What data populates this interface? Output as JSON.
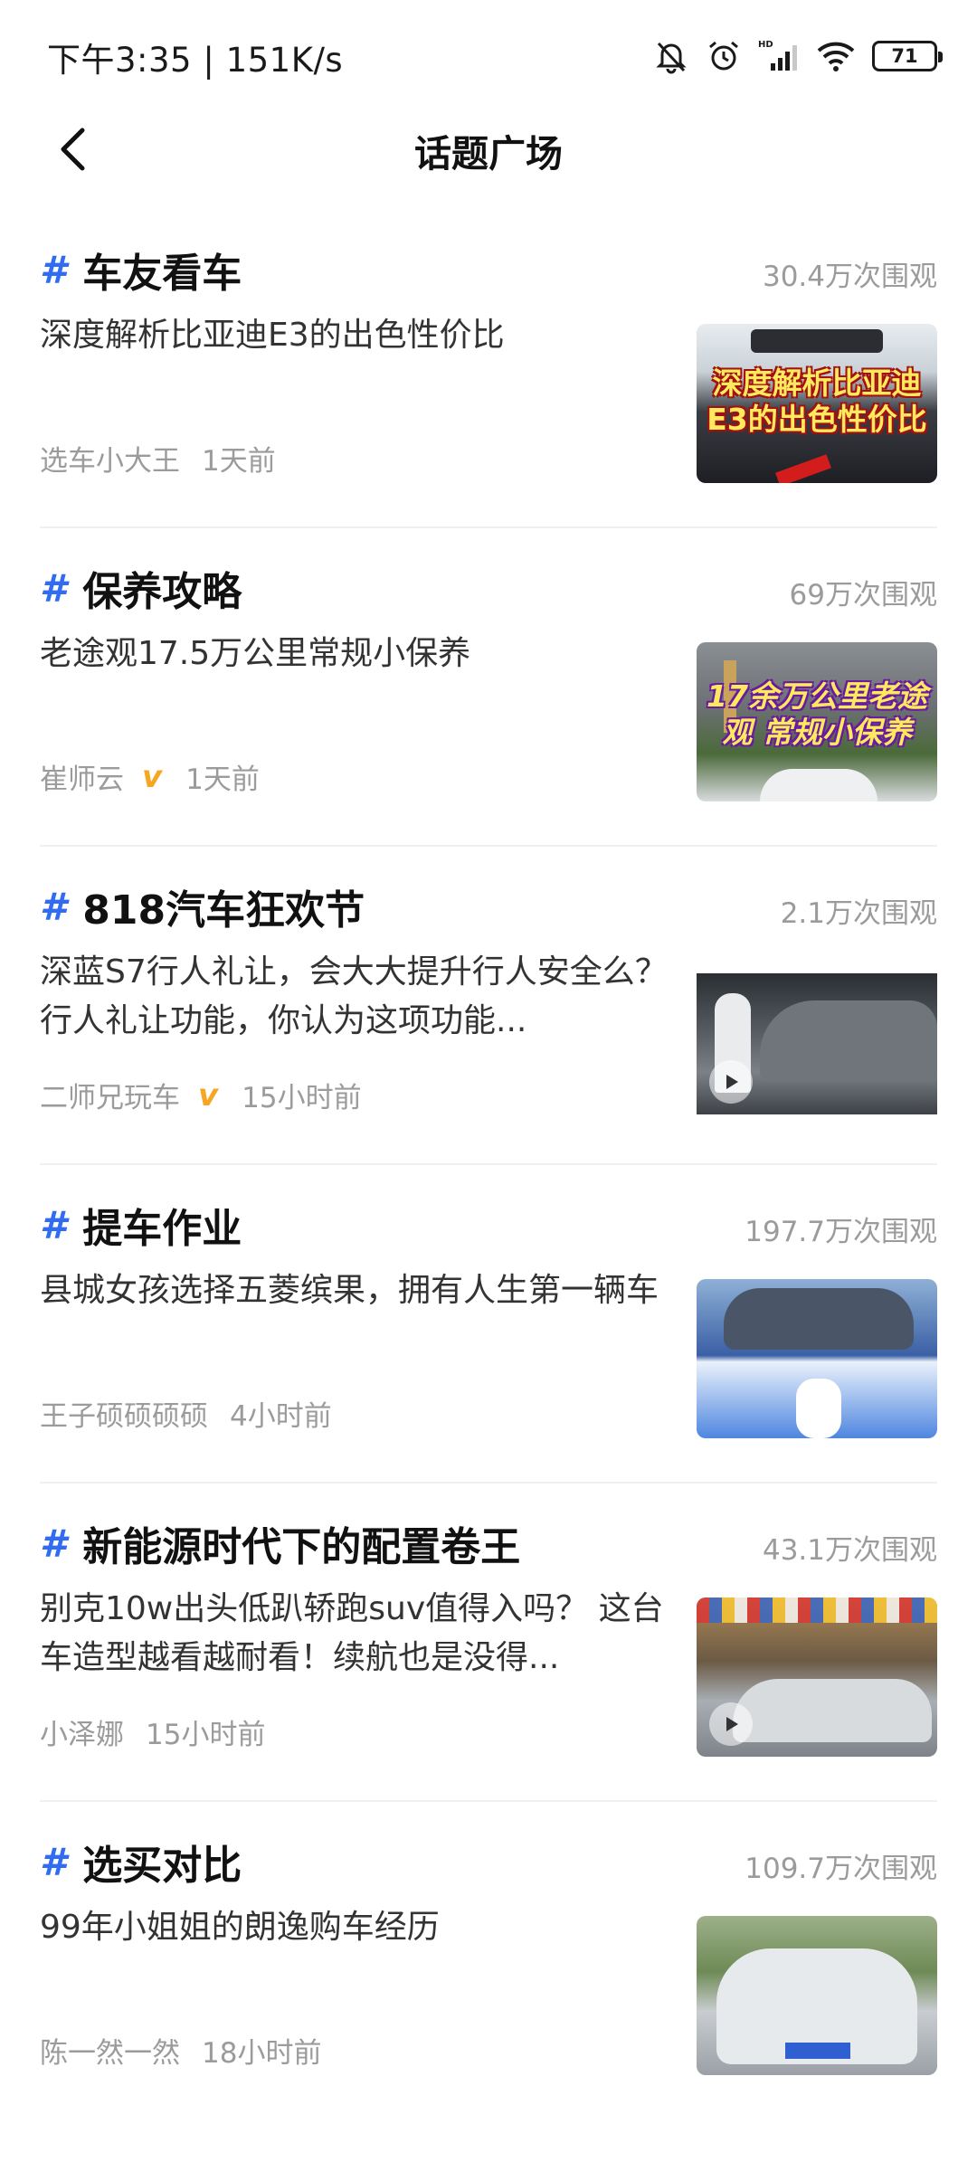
{
  "status_bar": {
    "time_speed": "下午3:35 | 151K/s",
    "battery_level": "71",
    "icons": [
      "bell-muted-icon",
      "alarm-icon",
      "hd-signal-icon",
      "wifi-icon",
      "battery-icon"
    ]
  },
  "header": {
    "title": "话题广场",
    "back_icon": "chevron-left-icon"
  },
  "topics": [
    {
      "hash": "#",
      "name": "车友看车",
      "views": "30.4万次围观",
      "desc": "深度解析比亚迪E3的出色性价比",
      "author": "选车小大王",
      "verified": false,
      "time": "1天前",
      "thumb_caption": "深度解析比亚迪 E3的出色性价比",
      "thumb_video": false
    },
    {
      "hash": "#",
      "name": "保养攻略",
      "views": "69万次围观",
      "desc": "老途观17.5万公里常规小保养",
      "author": "崔师云",
      "verified": true,
      "verified_badge": "v",
      "time": "1天前",
      "thumb_caption": "17余万公里老途观 常规小保养",
      "thumb_video": false
    },
    {
      "hash": "#",
      "name": "818汽车狂欢节",
      "views": "2.1万次围观",
      "desc": "深蓝S7行人礼让，会大大提升行人安全么？ 行人礼让功能，你认为这项功能...",
      "author": "二师兄玩车",
      "verified": true,
      "verified_badge": "v",
      "time": "15小时前",
      "thumb_caption": "",
      "thumb_video": true
    },
    {
      "hash": "#",
      "name": "提车作业",
      "views": "197.7万次围观",
      "desc": "县城女孩选择五菱缤果，拥有人生第一辆车",
      "author": "王子硕硕硕硕",
      "verified": false,
      "time": "4小时前",
      "thumb_caption": "",
      "thumb_video": false
    },
    {
      "hash": "#",
      "name": "新能源时代下的配置卷王",
      "views": "43.1万次围观",
      "desc": "别克10w出头低趴轿跑suv值得入吗？ 这台车造型越看越耐看！续航也是没得...",
      "author": "小泽娜",
      "verified": false,
      "time": "15小时前",
      "thumb_caption": "",
      "thumb_video": true
    },
    {
      "hash": "#",
      "name": "选买对比",
      "views": "109.7万次围观",
      "desc": "99年小姐姐的朗逸购车经历",
      "author": "陈一然一然",
      "verified": false,
      "time": "18小时前",
      "thumb_caption": "",
      "thumb_video": false
    }
  ],
  "colors": {
    "accent": "#2f6cf2",
    "verified": "#f5a623",
    "muted_text": "#9b9b9b"
  }
}
